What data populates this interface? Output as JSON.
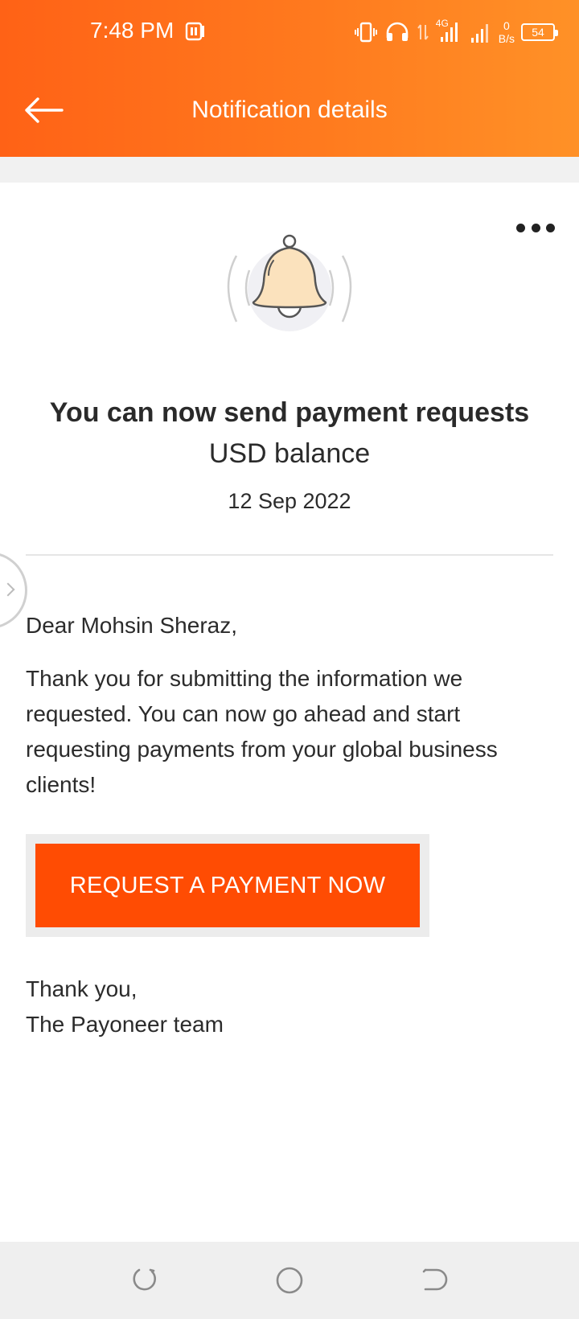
{
  "status_bar": {
    "time": "7:48 PM",
    "network": "4G",
    "net_speed_value": "0",
    "net_speed_unit": "B/s",
    "battery": "54",
    "icons": [
      "notification-app-icon",
      "vibrate-icon",
      "headphones-icon",
      "data-arrows-icon",
      "signal-icon",
      "signal-icon",
      "battery-icon"
    ]
  },
  "header": {
    "title": "Notification details",
    "back_icon": "back-arrow-icon",
    "background_start": "#ff6216",
    "background_end": "#ff9127"
  },
  "notification": {
    "icon": "bell-icon",
    "menu_icon": "more-icon",
    "title": "You can now send payment requests",
    "subtitle": "USD balance",
    "date": "12 Sep 2022"
  },
  "message": {
    "greeting": "Dear Mohsin Sheraz,",
    "body": "Thank you for submitting the information we requested. You can now go ahead and start requesting payments from your global business clients!",
    "cta_label": "REQUEST A PAYMENT NOW",
    "cta_color": "#ff4c03",
    "closing_line1": "Thank you,",
    "closing_line2": "The Payoneer team"
  },
  "nav_bar": {
    "icons": [
      "recents-icon",
      "home-icon",
      "back-icon"
    ]
  }
}
